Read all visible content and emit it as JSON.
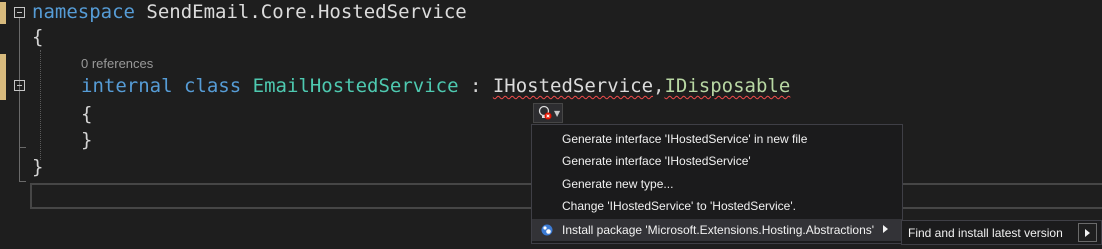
{
  "editor": {
    "namespace_keyword": "namespace",
    "namespace_name": "SendEmail.Core.HostedService",
    "open_brace_outer": "{",
    "codelens": "0 references",
    "class_keyword_internal": "internal",
    "class_keyword_class": "class",
    "class_name": "EmailHostedService",
    "colon": " : ",
    "interface1": "IHostedService",
    "comma": ",",
    "interface2": "IDisposable",
    "open_brace_inner": "{",
    "close_brace_inner": "}",
    "close_brace_outer": "}"
  },
  "quick_actions": {
    "items": [
      {
        "label": "Generate interface 'IHostedService' in new file"
      },
      {
        "label": "Generate interface 'IHostedService'"
      },
      {
        "label": "Generate new type..."
      },
      {
        "label": "Change 'IHostedService' to 'HostedService'."
      },
      {
        "label": "Install package 'Microsoft.Extensions.Hosting.Abstractions'"
      }
    ],
    "submenu": {
      "label": "Find and install latest version"
    }
  },
  "colors": {
    "keyword": "#569cd6",
    "type": "#4ec9b0",
    "interface": "#b8d7a3",
    "error_squiggle": "#f14c4c",
    "change_marker": "#d7ba7d"
  }
}
